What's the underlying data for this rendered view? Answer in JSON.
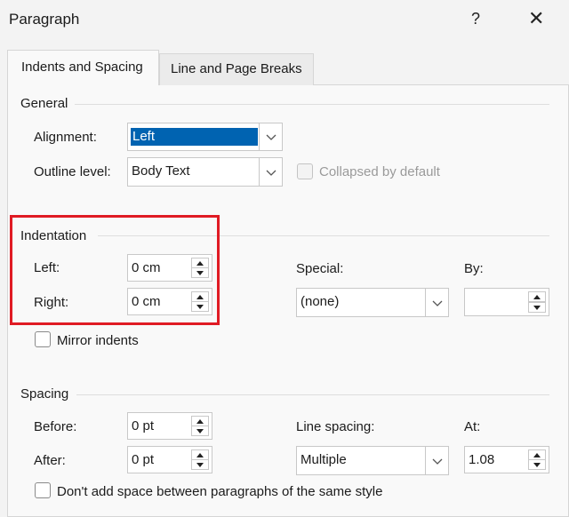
{
  "dialog": {
    "title": "Paragraph",
    "help": "?",
    "close": "✕"
  },
  "tabs": [
    {
      "label": "Indents and Spacing",
      "active": true
    },
    {
      "label": "Line and Page Breaks",
      "active": false
    }
  ],
  "general": {
    "header": "General",
    "alignment_label": "Alignment:",
    "alignment_value": "Left",
    "outline_label": "Outline level:",
    "outline_value": "Body Text",
    "collapsed_label": "Collapsed by default"
  },
  "indentation": {
    "header": "Indentation",
    "left_label": "Left:",
    "left_value": "0 cm",
    "right_label": "Right:",
    "right_value": "0 cm",
    "special_label": "Special:",
    "special_value": "(none)",
    "by_label": "By:",
    "by_value": "",
    "mirror_label": "Mirror indents"
  },
  "spacing": {
    "header": "Spacing",
    "before_label": "Before:",
    "before_value": "0 pt",
    "after_label": "After:",
    "after_value": "0 pt",
    "line_spacing_label": "Line spacing:",
    "line_spacing_value": "Multiple",
    "at_label": "At:",
    "at_value": "1.08",
    "dont_add_label": "Don't add space between paragraphs of the same style"
  },
  "colors": {
    "highlight_box": "#e01b24",
    "selection": "#0063b1"
  }
}
